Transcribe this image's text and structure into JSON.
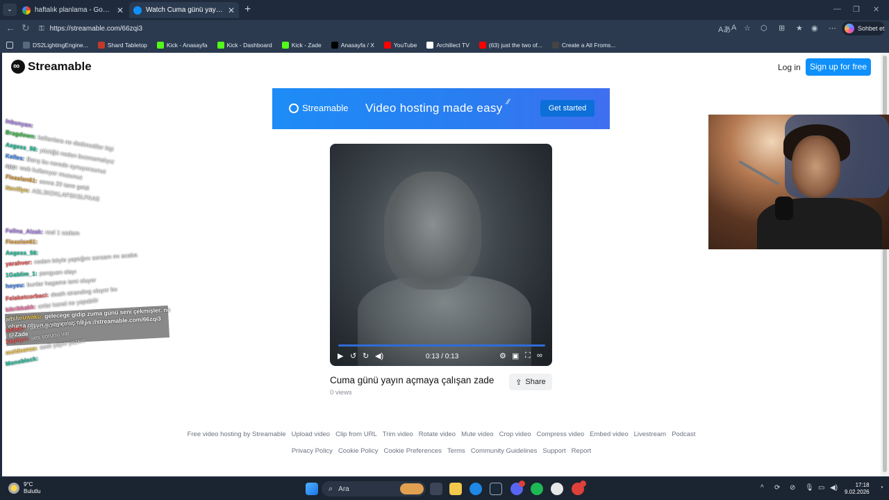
{
  "browser": {
    "tabs": [
      {
        "title": "haftalık planlama - Google'da Ara"
      },
      {
        "title": "Watch Cuma günü yayın açmaya ç"
      }
    ],
    "address": {
      "url": "https://streamable.com/66zqi3"
    },
    "copilot_label": "Sohbet et",
    "bookmarks": [
      {
        "label": "DS2LightingEngine...",
        "color": "#5a6a7e"
      },
      {
        "label": "Shard Tabletop",
        "color": "#c0392b"
      },
      {
        "label": "Kick - Anasayfa",
        "color": "#53fc18"
      },
      {
        "label": "Kick - Dashboard",
        "color": "#53fc18"
      },
      {
        "label": "Kick - Zade",
        "color": "#53fc18"
      },
      {
        "label": "Anasayfa / X",
        "color": "#000000"
      },
      {
        "label": "YouTube",
        "color": "#ff0000"
      },
      {
        "label": "Archillect TV",
        "color": "#ffffff"
      },
      {
        "label": "(63) just the two of...",
        "color": "#ff0000"
      },
      {
        "label": "Create a All Froms...",
        "color": "#444444"
      }
    ]
  },
  "site": {
    "brand": "Streamable",
    "login_label": "Log in",
    "signup_label": "Sign up for free",
    "banner": {
      "brand": "Streamable",
      "tagline": "Video hosting made easy",
      "cta": "Get started"
    },
    "player": {
      "time": "0:13 / 0:13",
      "progress": 1.0
    },
    "video_title": "Cuma günü yayın açmaya çalışan zade",
    "views": "0 views",
    "share_label": "Share",
    "footer_links_1": [
      "Free video hosting by Streamable",
      "Upload video",
      "Clip from URL",
      "Trim video",
      "Rotate video",
      "Mute video",
      "Crop video",
      "Compress video",
      "Embed video",
      "Livestream",
      "Podcast"
    ],
    "footer_links_2": [
      "Privacy Policy",
      "Cookie Policy",
      "Cookie Preferences",
      "Terms",
      "Community Guidelines",
      "Support",
      "Report"
    ],
    "accent_color": "#0f90fa"
  },
  "chat": {
    "messages": [
      {
        "user": "lnbunyan:",
        "text": "",
        "color": "#b084f5"
      },
      {
        "user": "Bragdown:",
        "text": "kaftanlara ne dedimodiler kişi",
        "color": "#38c14a"
      },
      {
        "user": "Aegess_56:",
        "text": "yüzüğü neden bozmamalıyız",
        "color": "#18c7a0"
      },
      {
        "user": "Kelles:",
        "text": "Barış bu nerede oynuyorsunuz",
        "color": "#3f8bff"
      },
      {
        "user": "app:",
        "text": "web kullanıyor musunuz",
        "color": "#dddddd"
      },
      {
        "user": "Fleaslan61:",
        "text": "sonra 20 tane geldi",
        "color": "#e6a23c"
      },
      {
        "user": "Nevillyn:",
        "text": "ASL3KDKLAFSKSLFKAS",
        "color": "#f2c94c"
      },
      {
        "user": "Fellna_Alzak:",
        "text": "real 1 sadam",
        "color": "#b084f5"
      },
      {
        "user": "Fleaslan61:",
        "text": "",
        "color": "#e6a23c"
      },
      {
        "user": "Aegess_56:",
        "text": "",
        "color": "#18c7a0"
      },
      {
        "user": "yarahver:",
        "text": "neden böyle yaptığını sorsam mı acaba",
        "color": "#ff5a5a"
      },
      {
        "user": "1Gablim_1:",
        "text": "penguen olayı",
        "color": "#18c7a0"
      },
      {
        "user": "hoyeu:",
        "text": "bunlar hagame ismi oluyor",
        "color": "#3f8bff"
      },
      {
        "user": "Felaketcorbaci:",
        "text": "death stranding oluyor bu",
        "color": "#ff5a5a"
      },
      {
        "user": "kikrikkakk:",
        "text": "onlar kanal ne yapabilir",
        "color": "#ff6fa8"
      },
      {
        "user": "aibilir",
        "text": "",
        "color": "#dddddd"
      },
      {
        "user": "AEfsK:",
        "text": "hakettiğimizi çekeceğiz",
        "color": "#ff5a5a"
      },
      {
        "user": "Xephyrı:",
        "text": "ses sorunu var",
        "color": "#ff5a5a"
      },
      {
        "user": "moldeanza:",
        "text": "sesli yayın yazsın",
        "color": "#ffd24a"
      },
      {
        "user": "Monoblock:",
        "text": "",
        "color": "#18c7a0"
      }
    ],
    "highlight": {
      "user": "wakuuwaku:",
      "line1": "gelecege gidip zuma günü seni çekmişler. ne",
      "line2": "olursa olsun o yayını aç",
      "link": "https://streamable.com/66zqi3",
      "mention": "@Zade"
    }
  },
  "taskbar": {
    "weather_temp": "9°C",
    "weather_desc": "Bulutlu",
    "search_placeholder": "Ara",
    "time": "17:18",
    "date": "9.02.2026"
  }
}
